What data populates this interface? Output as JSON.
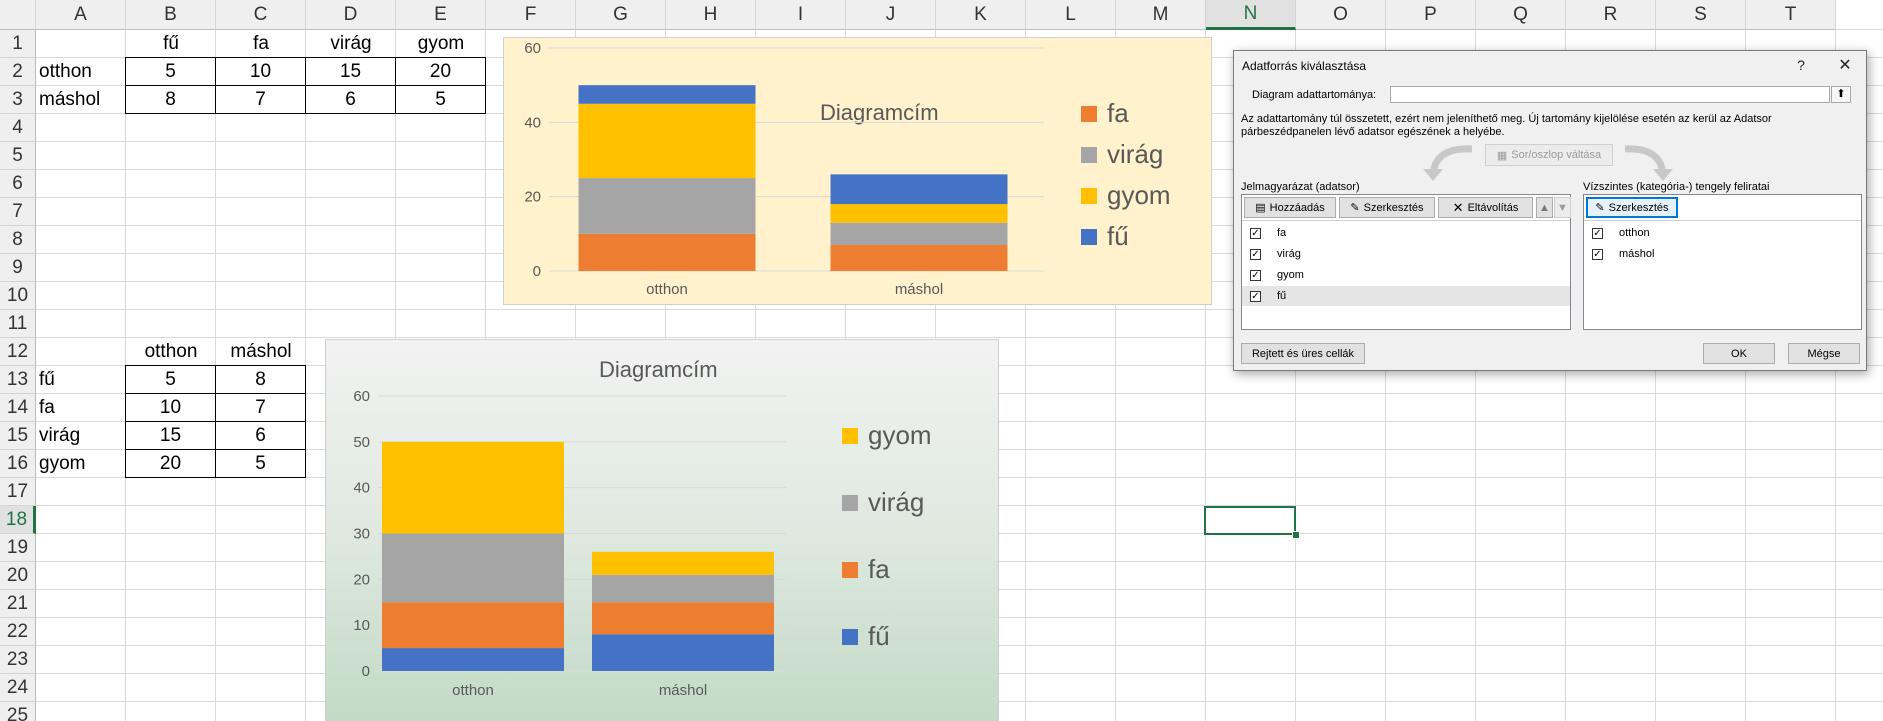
{
  "sheet": {
    "columns": [
      "A",
      "B",
      "C",
      "D",
      "E",
      "F",
      "G",
      "H",
      "I",
      "J",
      "K",
      "L",
      "M",
      "N",
      "O",
      "P",
      "Q",
      "R",
      "S",
      "T"
    ],
    "rows": [
      "1",
      "2",
      "3",
      "4",
      "5",
      "6",
      "7",
      "8",
      "9",
      "10",
      "11",
      "12",
      "13",
      "14",
      "15",
      "16",
      "17",
      "18",
      "19",
      "20",
      "21",
      "22",
      "23",
      "24",
      "25"
    ],
    "selected_column": "N",
    "selected_row": "18",
    "table1": {
      "headers": [
        "fű",
        "fa",
        "virág",
        "gyom"
      ],
      "rows": [
        {
          "label": "otthon",
          "values": [
            "5",
            "10",
            "15",
            "20"
          ]
        },
        {
          "label": "máshol",
          "values": [
            "8",
            "7",
            "6",
            "5"
          ]
        }
      ]
    },
    "table2": {
      "headers": [
        "otthon",
        "máshol"
      ],
      "rows": [
        {
          "label": "fű",
          "values": [
            "5",
            "8"
          ]
        },
        {
          "label": "fa",
          "values": [
            "10",
            "7"
          ]
        },
        {
          "label": "virág",
          "values": [
            "15",
            "6"
          ]
        },
        {
          "label": "gyom",
          "values": [
            "20",
            "5"
          ]
        }
      ]
    }
  },
  "chart_data": [
    {
      "type": "bar",
      "stacked": true,
      "title": "Diagramcím",
      "categories": [
        "otthon",
        "máshol"
      ],
      "ylim": [
        0,
        60
      ],
      "yticks": [
        "0",
        "20",
        "40",
        "60"
      ],
      "background": "#fff2cc",
      "series": [
        {
          "name": "fa",
          "values": [
            10,
            7
          ],
          "color": "#ed7d31"
        },
        {
          "name": "virág",
          "values": [
            15,
            6
          ],
          "color": "#a5a5a5"
        },
        {
          "name": "gyom",
          "values": [
            20,
            5
          ],
          "color": "#ffc000"
        },
        {
          "name": "fű",
          "values": [
            5,
            8
          ],
          "color": "#4472c4"
        }
      ],
      "legend": [
        "fa",
        "virág",
        "gyom",
        "fű"
      ],
      "legend_position": "right"
    },
    {
      "type": "bar",
      "stacked": true,
      "title": "Diagramcím",
      "categories": [
        "otthon",
        "máshol"
      ],
      "ylim": [
        0,
        60
      ],
      "yticks": [
        "0",
        "10",
        "20",
        "30",
        "40",
        "50",
        "60"
      ],
      "background": "gradient-grey-to-green",
      "series": [
        {
          "name": "fű",
          "values": [
            5,
            8
          ],
          "color": "#4472c4"
        },
        {
          "name": "fa",
          "values": [
            10,
            7
          ],
          "color": "#ed7d31"
        },
        {
          "name": "virág",
          "values": [
            15,
            6
          ],
          "color": "#a5a5a5"
        },
        {
          "name": "gyom",
          "values": [
            20,
            5
          ],
          "color": "#ffc000"
        }
      ],
      "legend": [
        "gyom",
        "virág",
        "fa",
        "fű"
      ],
      "legend_position": "right"
    }
  ],
  "dialog": {
    "title": "Adatforrás kiválasztása",
    "help": "?",
    "close": "✕",
    "range_label": "Diagram adattartománya:",
    "range_value": "",
    "info_line1": "Az adattartomány túl összetett, ezért nem jeleníthető meg. Új tartomány kijelölése esetén az kerül az Adatsor",
    "info_line2": "párbeszédpanelen lévő adatsor egészének a helyébe.",
    "switch_label": "Sor/oszlop váltása",
    "legend_header": "Jelmagyarázat (adatsor)",
    "add_label": "Hozzáadás",
    "edit_label": "Szerkesztés",
    "remove_label": "Eltávolítás",
    "legend_items": [
      "fa",
      "virág",
      "gyom",
      "fű"
    ],
    "axis_header": "Vízszintes (kategória-) tengely feliratai",
    "axis_edit_label": "Szerkesztés",
    "axis_items": [
      "otthon",
      "máshol"
    ],
    "hidden_cells_label": "Rejtett és üres cellák",
    "ok_label": "OK",
    "cancel_label": "Mégse"
  }
}
